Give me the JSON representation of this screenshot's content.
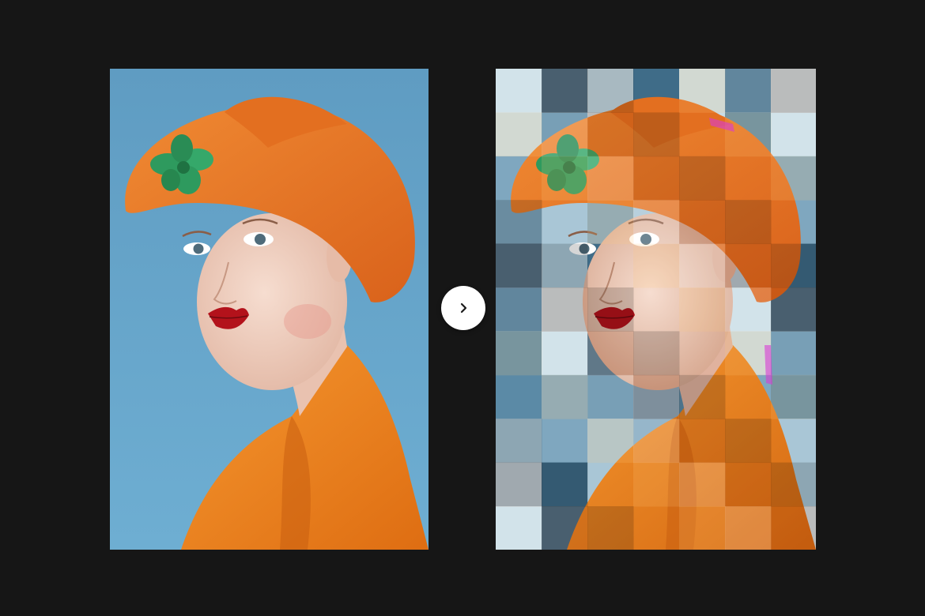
{
  "comparison": {
    "before": {
      "image_subject": "portrait-woman-orange-hat"
    },
    "after": {
      "image_subject": "portrait-woman-orange-hat",
      "effect": "pixel-mosaic"
    },
    "next_button": {
      "icon": "chevron-right-icon",
      "label": ""
    }
  },
  "colors": {
    "page_background": "#161616",
    "sky_blue": "#6aa6c9",
    "hat_orange": "#ea7a25",
    "coat_orange": "#f08a23",
    "leaf_green": "#2e9a5e",
    "lip_red": "#b3121b",
    "skin": "#efd2c3",
    "mosaic_light": "#c9dde6",
    "mosaic_mid": "#7fa7bf",
    "mosaic_dark": "#3f6c88"
  }
}
